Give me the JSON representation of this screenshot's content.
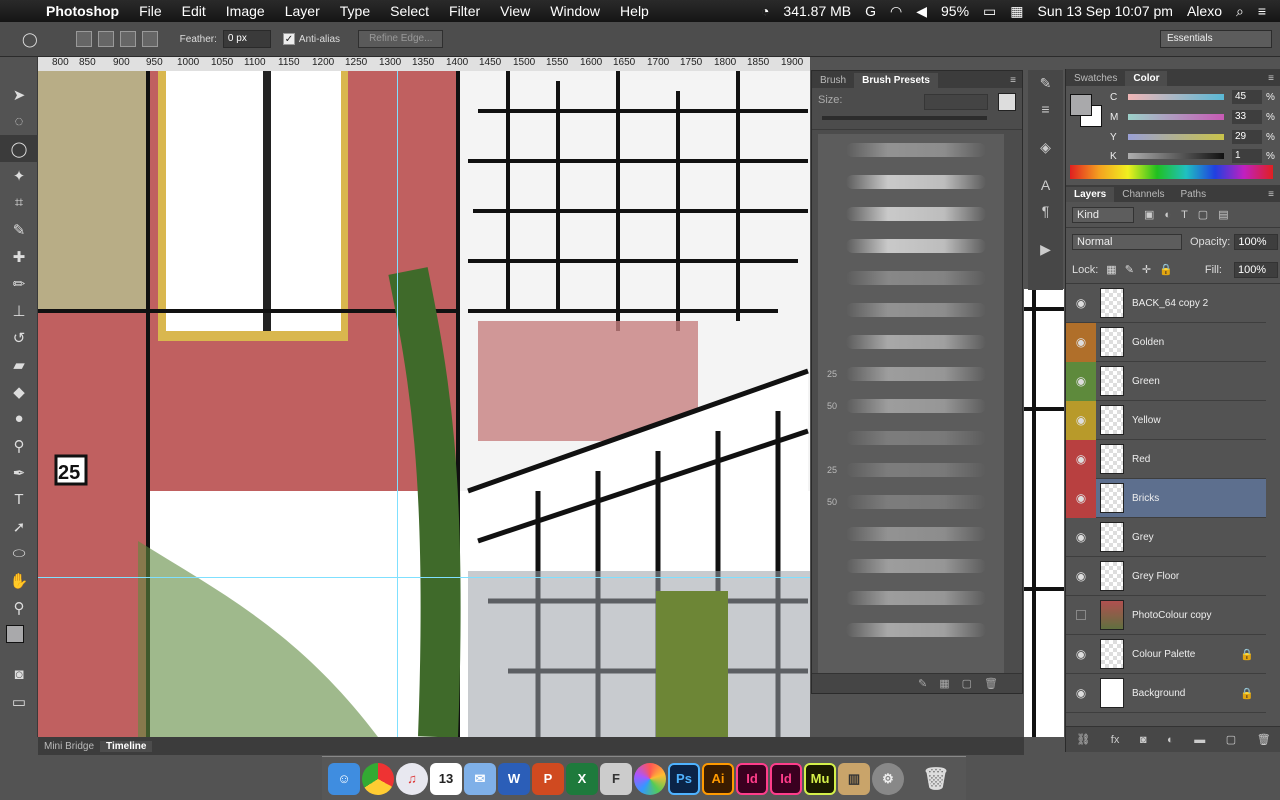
{
  "menubar": {
    "apple": "",
    "app": "Photoshop",
    "menus": [
      "File",
      "Edit",
      "Image",
      "Layer",
      "Type",
      "Select",
      "Filter",
      "View",
      "Window",
      "Help"
    ],
    "memory": "341.87 MB",
    "battery": "95%",
    "datetime": "Sun 13 Sep 10:07 pm",
    "user": "Alexo"
  },
  "options": {
    "feather_label": "Feather:",
    "feather_value": "0 px",
    "antialias_label": "Anti-alias",
    "refine": "Refine Edge...",
    "workspace": "Essentials"
  },
  "ruler": [
    "800",
    "850",
    "900",
    "950",
    "1000",
    "1050",
    "1100",
    "1150",
    "1200",
    "1250",
    "1300",
    "1350",
    "1400",
    "1450",
    "1500",
    "1550",
    "1600",
    "1650",
    "1700",
    "1750",
    "1800",
    "1850",
    "1900",
    "1950",
    "2000",
    "2050",
    "2100",
    "2150",
    "2200"
  ],
  "brushpanel": {
    "tabs": [
      "Brush",
      "Brush Presets"
    ],
    "size_label": "Size:",
    "numbers": [
      "25",
      "50",
      "25",
      "50"
    ]
  },
  "colorpanel": {
    "tabs": [
      "Swatches",
      "Color"
    ],
    "c": "45",
    "m": "33",
    "y": "29",
    "k": "1",
    "labels": [
      "C",
      "M",
      "Y",
      "K"
    ],
    "pct": "%"
  },
  "layerspanel": {
    "tabs": [
      "Layers",
      "Channels",
      "Paths"
    ],
    "kind": "Kind",
    "blend": "Normal",
    "opacity_label": "Opacity:",
    "opacity": "100%",
    "lock_label": "Lock:",
    "fill_label": "Fill:",
    "fill": "100%",
    "layers": [
      {
        "name": "BACK_64 copy 2",
        "tag": ""
      },
      {
        "name": "Golden",
        "tag": "#b06f2a"
      },
      {
        "name": "Green",
        "tag": "#5e8a3c"
      },
      {
        "name": "Yellow",
        "tag": "#b89a2a"
      },
      {
        "name": "Red",
        "tag": "#b84040"
      },
      {
        "name": "Bricks",
        "tag": "#b84040"
      },
      {
        "name": "Grey",
        "tag": ""
      },
      {
        "name": "Grey Floor",
        "tag": ""
      },
      {
        "name": "PhotoColour copy",
        "tag": ""
      },
      {
        "name": "Colour Palette",
        "tag": ""
      },
      {
        "name": "Background",
        "tag": ""
      }
    ]
  },
  "bottombar": {
    "tabs": [
      "Mini Bridge",
      "Timeline"
    ]
  },
  "dock": {
    "apps": [
      "W",
      "P",
      "X",
      "F",
      "Ps",
      "Ai",
      "Id",
      "Id",
      "Mu"
    ],
    "calendar_day": "13"
  }
}
